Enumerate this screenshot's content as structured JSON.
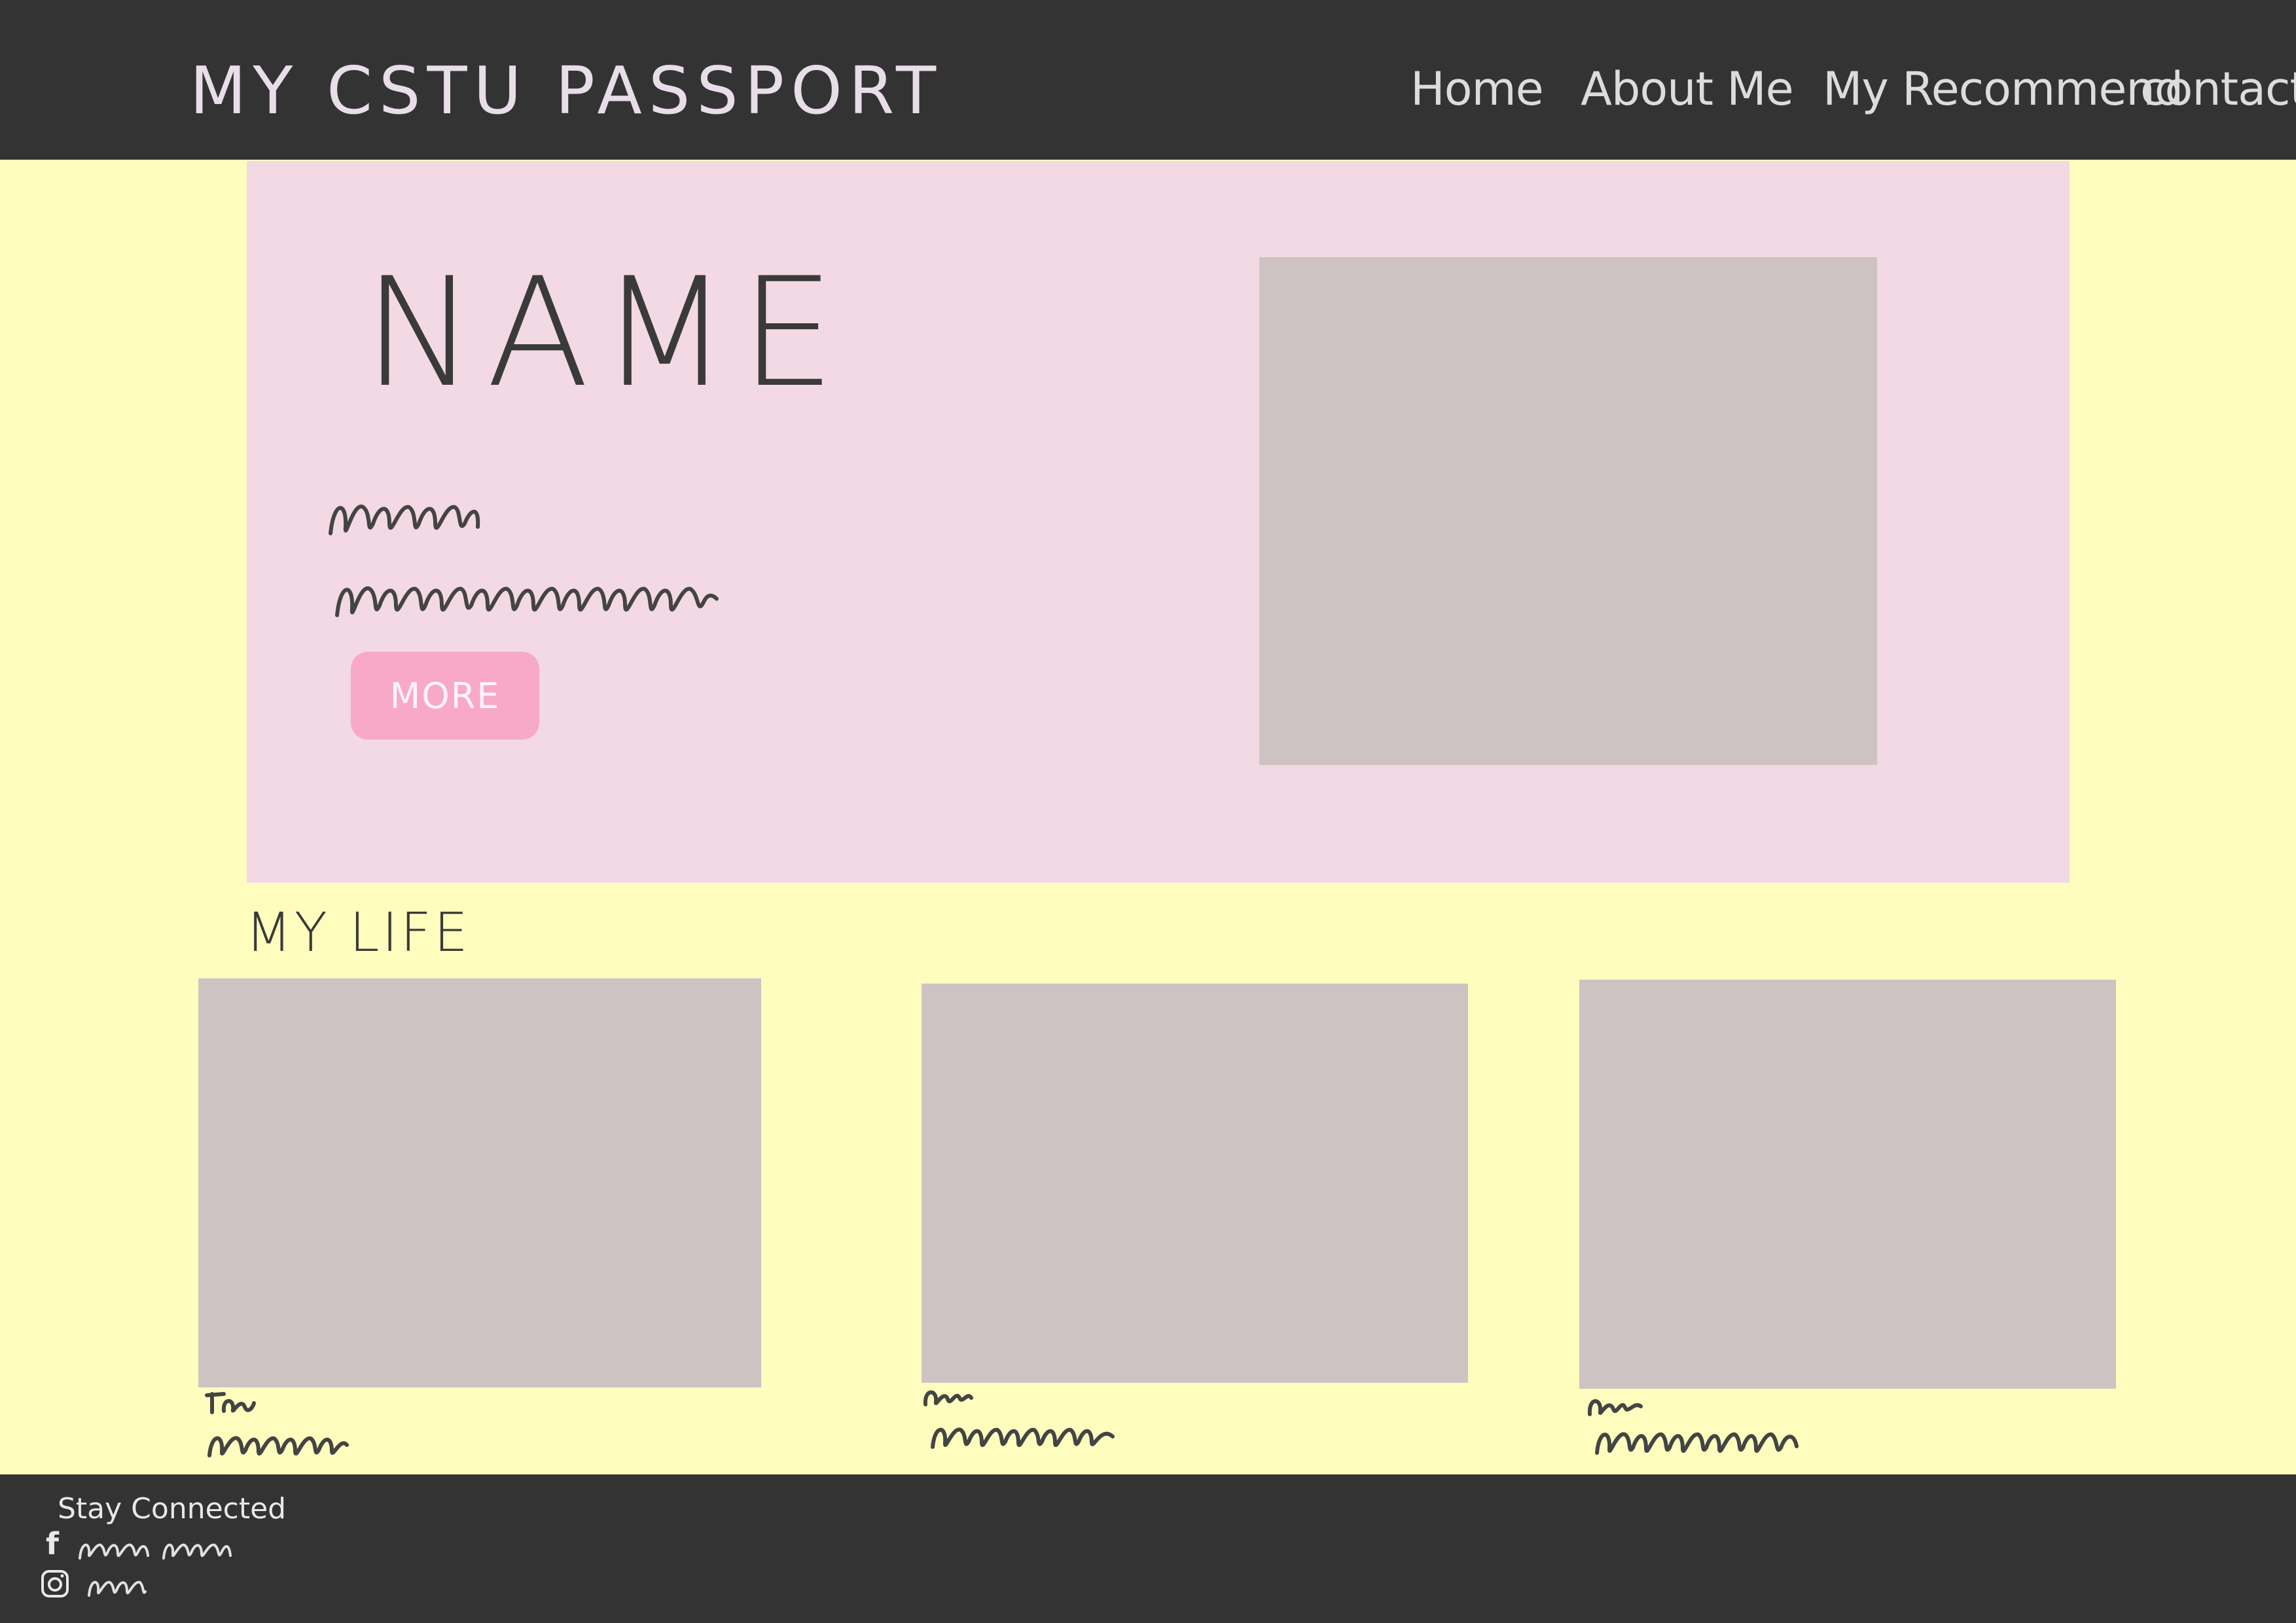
{
  "header": {
    "site_title": "MY CSTU PASSPORT",
    "nav": [
      "Home",
      "About Me",
      "My Recommend",
      "contact"
    ]
  },
  "hero": {
    "name": "NAME",
    "more_label": "MORE"
  },
  "section": {
    "title": "MY LIFE"
  },
  "footer": {
    "heading": "Stay Connected",
    "social_icons": [
      "facebook-icon",
      "instagram-icon"
    ]
  },
  "colors": {
    "background": "#FFFDBD",
    "header_footer": "#333333",
    "hero_panel": "#F2D9E4",
    "button": "#F7A9C7",
    "image_placeholder": "#CDC3C3"
  }
}
